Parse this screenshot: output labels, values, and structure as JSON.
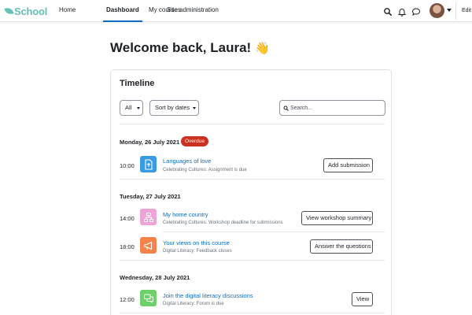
{
  "brand": {
    "name": "School"
  },
  "nav": {
    "items": [
      {
        "label": "Home"
      },
      {
        "label": "Dashboard",
        "active": true
      },
      {
        "label": "My courses"
      },
      {
        "label": "Site administration"
      }
    ],
    "icons": [
      "search-icon",
      "bell-icon",
      "chat-icon"
    ],
    "edit_label": "Edit"
  },
  "page": {
    "title": "Welcome back, Laura!",
    "emoji": "👋"
  },
  "timeline": {
    "title": "Timeline",
    "filter_label": "All",
    "sort_label": "Sort by dates",
    "search_placeholder": "Search...",
    "days": [
      {
        "date": "Monday, 26 July 2021",
        "badge": "Overdue",
        "events": [
          {
            "time": "10:00",
            "title": "Languages of love",
            "subtitle": "Celebrating Cultures: Assignment is due",
            "action": "Add submission",
            "icon": "assignment-icon",
            "color": "#399be2"
          }
        ]
      },
      {
        "date": "Tuesday, 27 July 2021",
        "events": [
          {
            "time": "14:00",
            "title": "My home country",
            "subtitle": "Celebrating Cultures: Workshop deadline for submissions",
            "action": "View workshop summary",
            "icon": "workshop-icon",
            "color": "#f0a3d8"
          },
          {
            "time": "18:00",
            "title": "Your views on this course",
            "subtitle": "Digital Literacy: Feedback closes",
            "action": "Answer the questions",
            "icon": "feedback-icon",
            "color": "#f7834a"
          }
        ]
      },
      {
        "date": "Wednesday, 28 July 2021",
        "events": [
          {
            "time": "12:00",
            "title": "Join the digital literacy discussions",
            "subtitle": "Digital Literacy: Forum is due",
            "action": "View",
            "icon": "forum-icon",
            "color": "#6fd06b"
          }
        ]
      }
    ]
  },
  "colors": {
    "brand": "#66c1b7",
    "link": "#0f6cbf",
    "overdue": "#ca3120",
    "active_nav": "#0f6cbf"
  }
}
